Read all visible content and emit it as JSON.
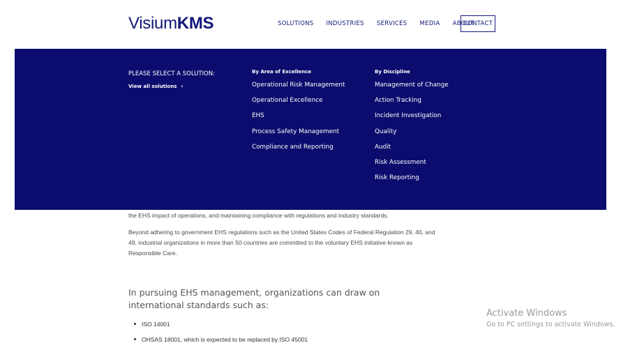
{
  "brand": {
    "logo_light": "Visium",
    "logo_bold": "KMS"
  },
  "nav": {
    "items": [
      "SOLUTIONS",
      "INDUSTRIES",
      "SERVICES",
      "MEDIA",
      "ABOUT"
    ],
    "contact": "CONTACT"
  },
  "mega_menu": {
    "select_title": "PLEASE SELECT A SOLUTION:",
    "view_all": "View all solutions",
    "area_heading": "By Area of Excellence",
    "area_items": [
      "Operational Risk Management",
      "Operational Excellence",
      "EHS",
      "Process Safety Management",
      "Compliance and Reporting"
    ],
    "discipline_heading": "By Discipline",
    "discipline_items": [
      "Management of Change",
      "Action Tracking",
      "Incident Investigation",
      "Quality",
      "Audit",
      "Risk Assessment",
      "Risk Reporting"
    ]
  },
  "content": {
    "para1_tail": "the EHS impact of operations, and maintaining compliance with regulations and industry standards.",
    "para2": "Beyond adhering to government EHS regulations such as the United States Codes of Federal Regulation 29, 40, and 49, industrial organizations in more than 50 countries are committed to the voluntary EHS initiative known as Responsible Care.",
    "subheading": "In pursuing EHS management, organizations can draw on international standards such as:",
    "bullets": [
      "ISO 14001",
      "OHSAS 18001, which is expected to be replaced by ISO 45001"
    ]
  },
  "watermark": {
    "title": "Activate Windows",
    "subtitle": "Go to PC settings to activate Windows."
  },
  "colors": {
    "brand_navy": "#0c0c6e",
    "text_navy": "#12177a"
  }
}
